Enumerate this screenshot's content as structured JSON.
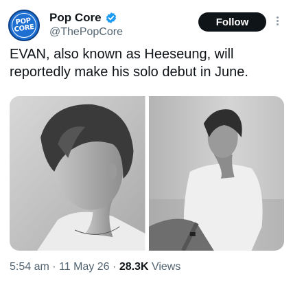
{
  "account": {
    "avatar_text_line1": "POP",
    "avatar_text_line2": "CORE",
    "display_name": "Pop Core",
    "handle": "@ThePopCore",
    "verified": true,
    "verified_color": "#1d9bf0",
    "avatar_color": "#1d6fd1"
  },
  "actions": {
    "follow_label": "Follow",
    "more_icon": "more-vertical-icon"
  },
  "tweet": {
    "text": "EVAN, also known as Heeseung, will reportedly make his solo debut in June."
  },
  "media": {
    "photos": [
      {
        "name": "photo-left"
      },
      {
        "name": "photo-right"
      }
    ]
  },
  "meta": {
    "time": "5:54 am",
    "date": "11 May 26",
    "views_count": "28.3K",
    "views_label": "Views",
    "separator": "·"
  }
}
